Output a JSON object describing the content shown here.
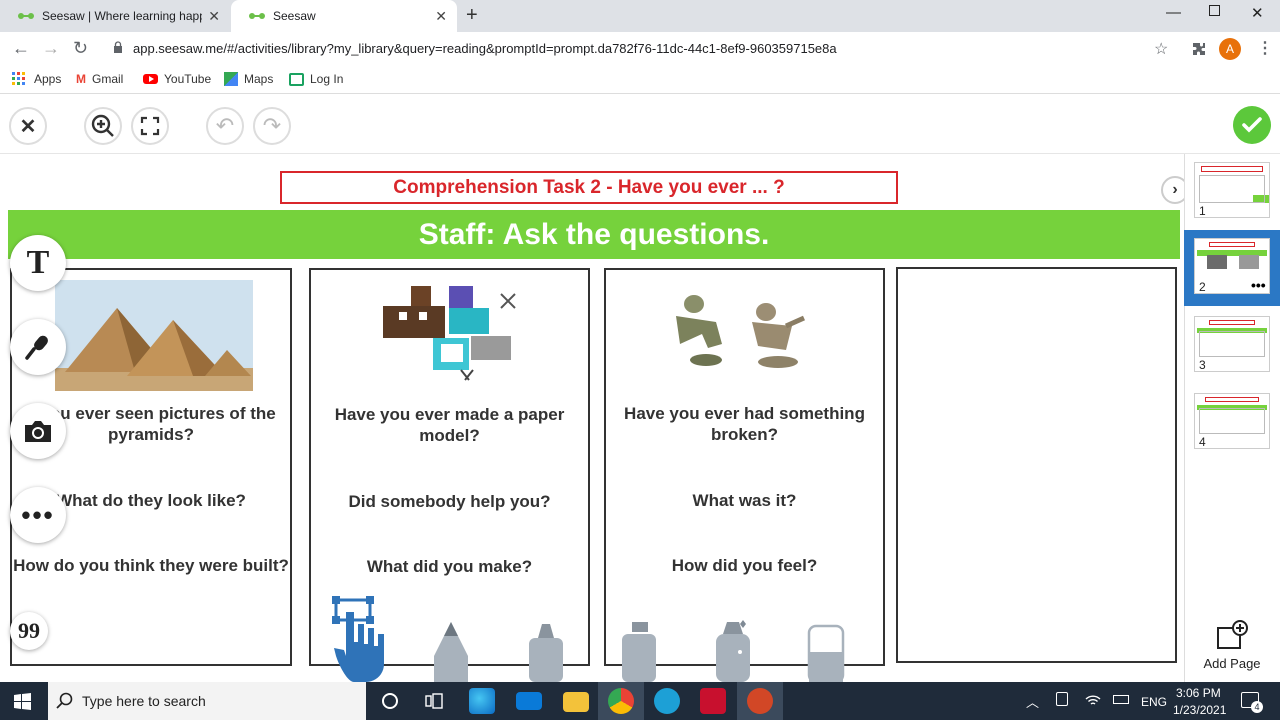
{
  "browser": {
    "tabs": [
      {
        "label": "Seesaw | Where learning happen",
        "active": false
      },
      {
        "label": "Seesaw",
        "active": true
      }
    ],
    "url": "app.seesaw.me/#/activities/library?my_library&query=reading&promptId=prompt.da782f76-11dc-44c1-8ef9-960359715e8a",
    "profile_initial": "A",
    "bookmarks": [
      "Apps",
      "Gmail",
      "YouTube",
      "Maps",
      "Log In"
    ]
  },
  "canvas": {
    "title": "Comprehension Task 2  - Have you ever ... ?",
    "banner": "Staff: Ask the questions.",
    "cards": [
      {
        "q1": "e you ever seen pictures of the pyramids?",
        "q2": "What do they look like?",
        "q3": "How do you think they were built?"
      },
      {
        "q1": "Have you ever made a paper model?",
        "q2": "Did somebody help you?",
        "q3": "What did you make?"
      },
      {
        "q1": "Have you ever had something broken?",
        "q2": "What was it?",
        "q3": "How did you feel?"
      }
    ]
  },
  "side_tools": {
    "text_tool": "T",
    "quote_tool": "99"
  },
  "pages": {
    "numbers": [
      "1",
      "2",
      "3",
      "4"
    ],
    "selected": 2,
    "add_label": "Add Page"
  },
  "taskbar": {
    "search_placeholder": "Type here to search",
    "language": "ENG",
    "time": "3:06 PM",
    "date": "1/23/2021",
    "notification_count": "4"
  },
  "colors": {
    "accent_green": "#76d23c",
    "title_red": "#d9262b",
    "page_selected": "#2b78c5",
    "check_green": "#5cc83b"
  }
}
